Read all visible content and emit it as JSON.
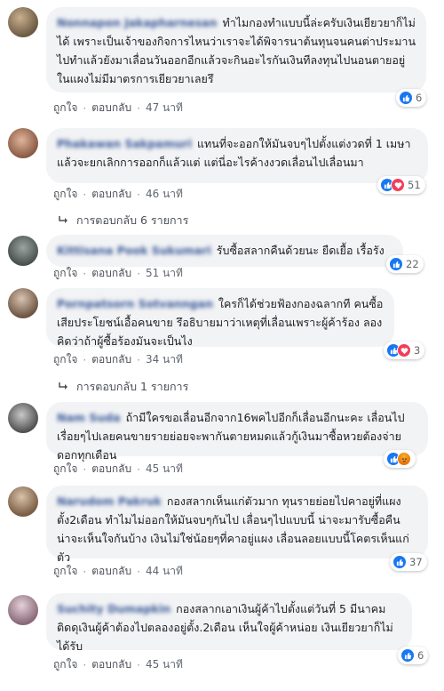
{
  "comments": [
    {
      "author": "Nonnapon Jakapharnesan",
      "text": "ทำไมกองทำแบบนี้ล่ะครับเงินเยียวยาก็ไม่ได้ เพราะเป็นเจ้าของกิจการไหนว่าเราจะได้พิจารนาต้นทุนจนคนต่าประมานไปทำแล้วยังมาเลื่อนวันออกอีกแล้วจะกินอะไรกันเงินทีลงทุนไปนอนตายอยู่ในแผงไม่มีมาตรการเยียวยาเลยรึ",
      "like": "ถูกใจ",
      "reply": "ตอบกลับ",
      "time": "47 นาที",
      "reaction_count": "6"
    },
    {
      "author": "Phakawan Sakpamuri",
      "text": "แทนที่จะออกให้มันจบๆไปตั้งแต่งวดที่ 1 เมษา แล้วจะยกเลิกการออกก็แล้วแต่ แต่นี่อะไรค้างงวดเลื่อนไปเลื่อนมา",
      "like": "ถูกใจ",
      "reply": "ตอบกลับ",
      "time": "46 นาที",
      "reaction_count": "51",
      "replies_label": "การตอบกลับ 6 รายการ"
    },
    {
      "author": "Kittisana Pook Sukumari",
      "text": "รับซื้อสลากคืนด้วยนะ ยืดเยื้อ เรื้อรัง",
      "like": "ถูกใจ",
      "reply": "ตอบกลับ",
      "time": "51 นาที",
      "reaction_count": "22"
    },
    {
      "author": "Pornpatsorn Sotvanngan",
      "text": "ใครก็ได้ช่วยฟ้องกองฉลากที คนซื้อเสียประโยชน์เอื้อคนขาย รึอธิบายมาว่าเหตุที่เลื่อนเพราะผู้ค้าร้อง ลองคิดว่าถ้าผู้ซื้อร้องมันจะเป็นไง",
      "like": "ถูกใจ",
      "reply": "ตอบกลับ",
      "time": "34 นาที",
      "reaction_count": "3",
      "replies_label": "การตอบกลับ 1 รายการ"
    },
    {
      "author": "Nam Suda",
      "text": "ถ้ามีใครขอเลื่อนอีกจาก16พคไปอีกก็เลื่อนอีกนะคะ เลื่อนไปเรื่อยๆไปเลยคนขายรายย่อยจะพากันตายหมดแล้วกู้เงินมาซื้อหวยต้องจ่ายดอกทุกเดือน",
      "like": "ถูกใจ",
      "reply": "ตอบกลับ",
      "time": "45 นาที"
    },
    {
      "author": "Narudom Pakruk",
      "text": "กองสลากเห็นแก่ตัวมาก ทุนรายย่อยไปคาอยู่ที่แผงตั้ง2เดือน ทำไมไม่ออกให้มันจบๆกันไป เลื่อนๆไปแบบนี้ น่าจะมารับซื้อคืน น่าจะเห็นใจกันบ้าง เงินไม่ใช่น้อยๆที่คาอยู่แผง เลื่อนลอยแบบนี้โคตรเห็นแก่ตัว",
      "like": "ถูกใจ",
      "reply": "ตอบกลับ",
      "time": "44 นาที",
      "reaction_count": "37"
    },
    {
      "author": "Suchity Dumapkin",
      "text": "กองสลากเอาเงินผู้ค้าไปตั้งแต่วันที่ 5 มีนาคม ติดดุเงินผู้ค้าต้องไปตลองอยู่ตั้ง.2เดือน เห็นใจผู้ค้าหน่อย เงินเยียวยาก็ไม่ได้รับ",
      "like": "ถูกใจ",
      "reply": "ตอบกลับ",
      "time": "45 นาที",
      "reaction_count": "6"
    }
  ],
  "colors": {
    "bubble": "#f2f3f5",
    "author": "#385898",
    "like": "#1877f2",
    "love": "#f33e58",
    "haha": "#f7b125",
    "angry": "#e9710f"
  }
}
